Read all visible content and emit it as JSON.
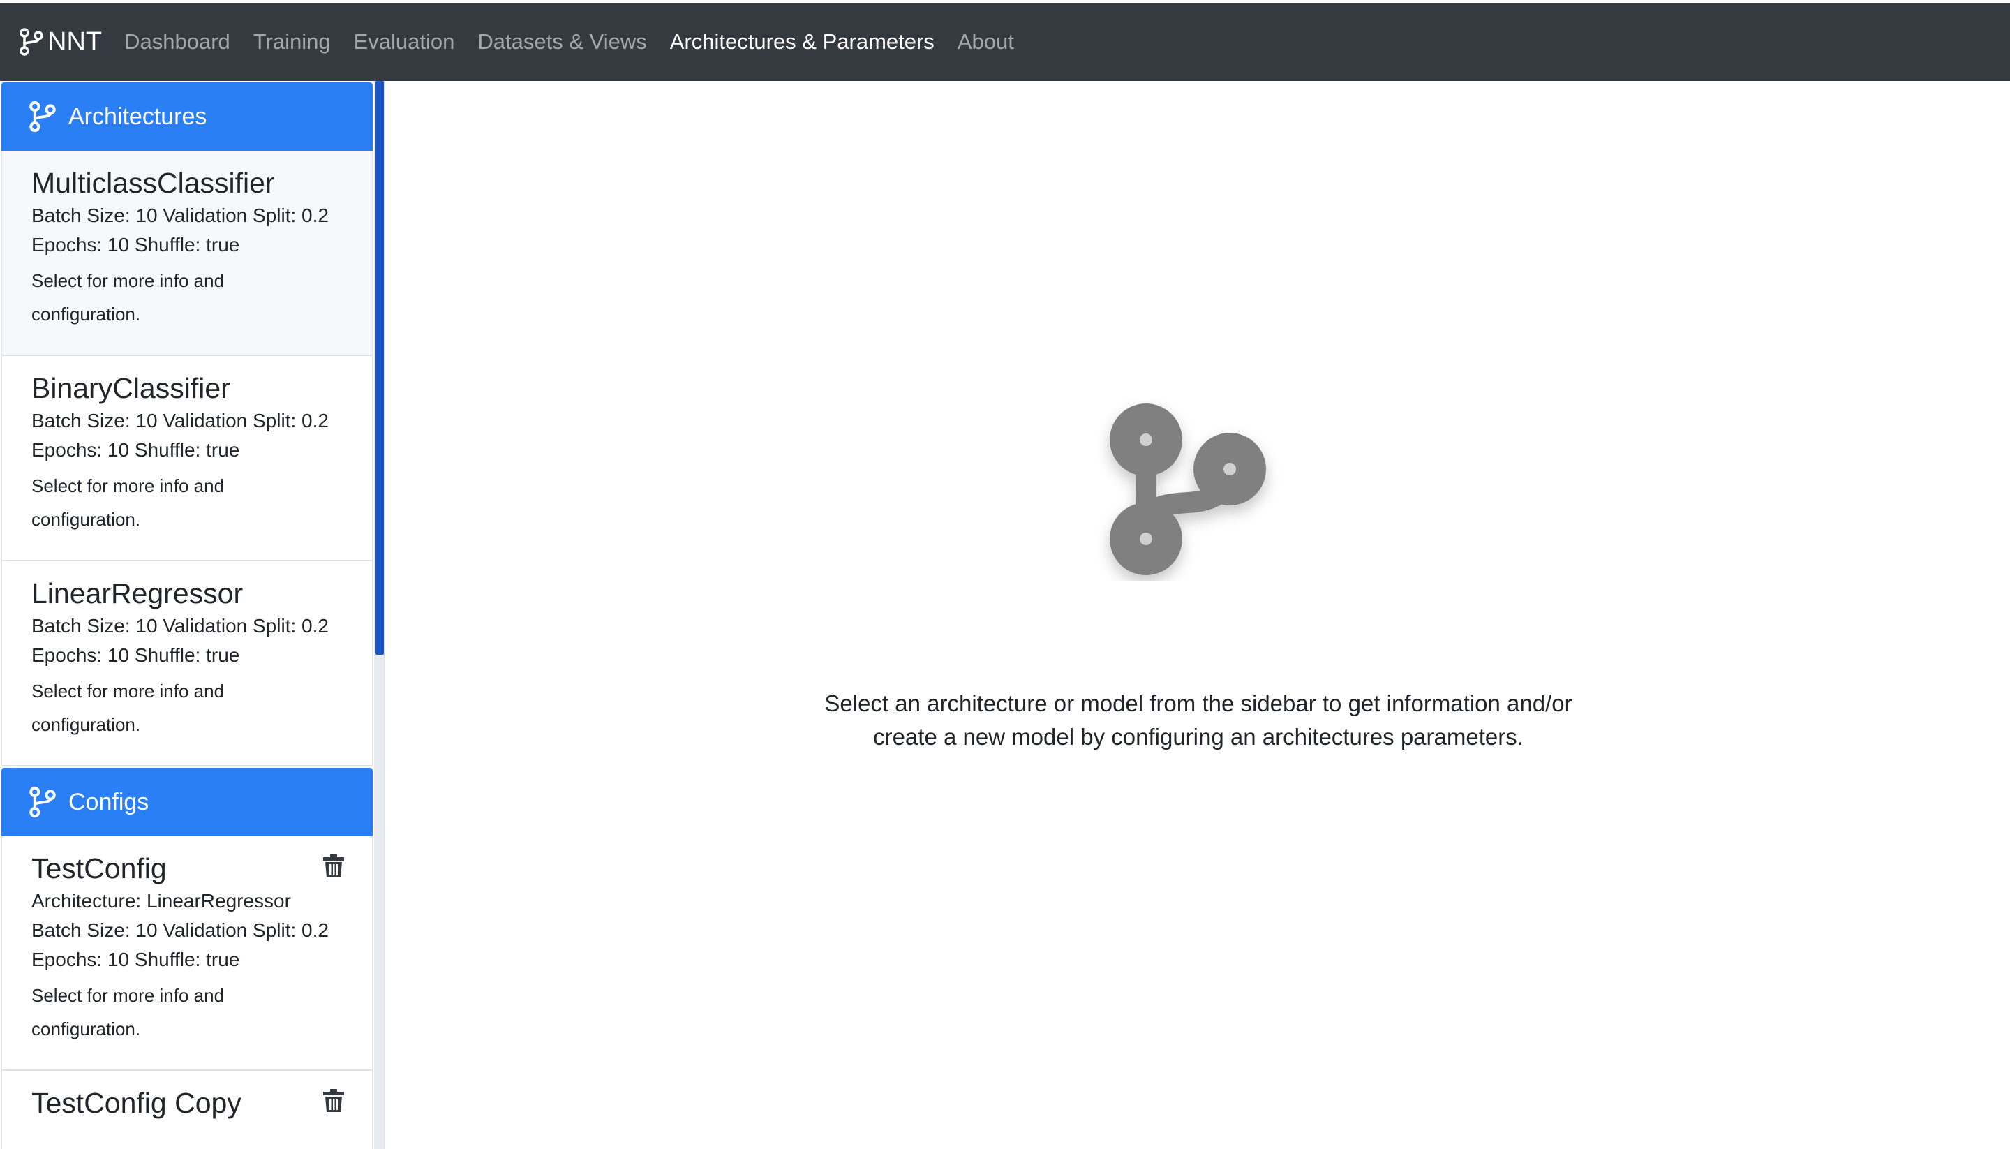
{
  "topbar": {
    "brand": "NNT",
    "nav": [
      {
        "label": "Dashboard",
        "active": false
      },
      {
        "label": "Training",
        "active": false
      },
      {
        "label": "Evaluation",
        "active": false
      },
      {
        "label": "Datasets & Views",
        "active": false
      },
      {
        "label": "Architectures & Parameters",
        "active": true
      },
      {
        "label": "About",
        "active": false
      }
    ]
  },
  "sidebar": {
    "architectures_header": "Architectures",
    "architectures": [
      {
        "name": "MulticlassClassifier",
        "line1": "Batch Size: 10 Validation Split: 0.2",
        "line2": "Epochs: 10 Shuffle: true",
        "note": "Select for more info and configuration."
      },
      {
        "name": "BinaryClassifier",
        "line1": "Batch Size: 10 Validation Split: 0.2",
        "line2": "Epochs: 10 Shuffle: true",
        "note": "Select for more info and configuration."
      },
      {
        "name": "LinearRegressor",
        "line1": "Batch Size: 10 Validation Split: 0.2",
        "line2": "Epochs: 10 Shuffle: true",
        "note": "Select for more info and configuration."
      }
    ],
    "configs_header": "Configs",
    "configs": [
      {
        "name": "TestConfig",
        "architecture": "Architecture: LinearRegressor",
        "line1": "Batch Size: 10 Validation Split: 0.2",
        "line2": "Epochs: 10 Shuffle: true",
        "note": "Select for more info and configuration."
      },
      {
        "name": "TestConfig Copy"
      }
    ]
  },
  "main": {
    "icon": "git-branch-icon",
    "message_line1": "Select an architecture or model from the sidebar to get information and/or",
    "message_line2": "create a new model by configuring an architectures parameters."
  },
  "colors": {
    "navbar": "#343a40",
    "header_blue": "#2b7ff5",
    "icon_gray": "#808080"
  }
}
